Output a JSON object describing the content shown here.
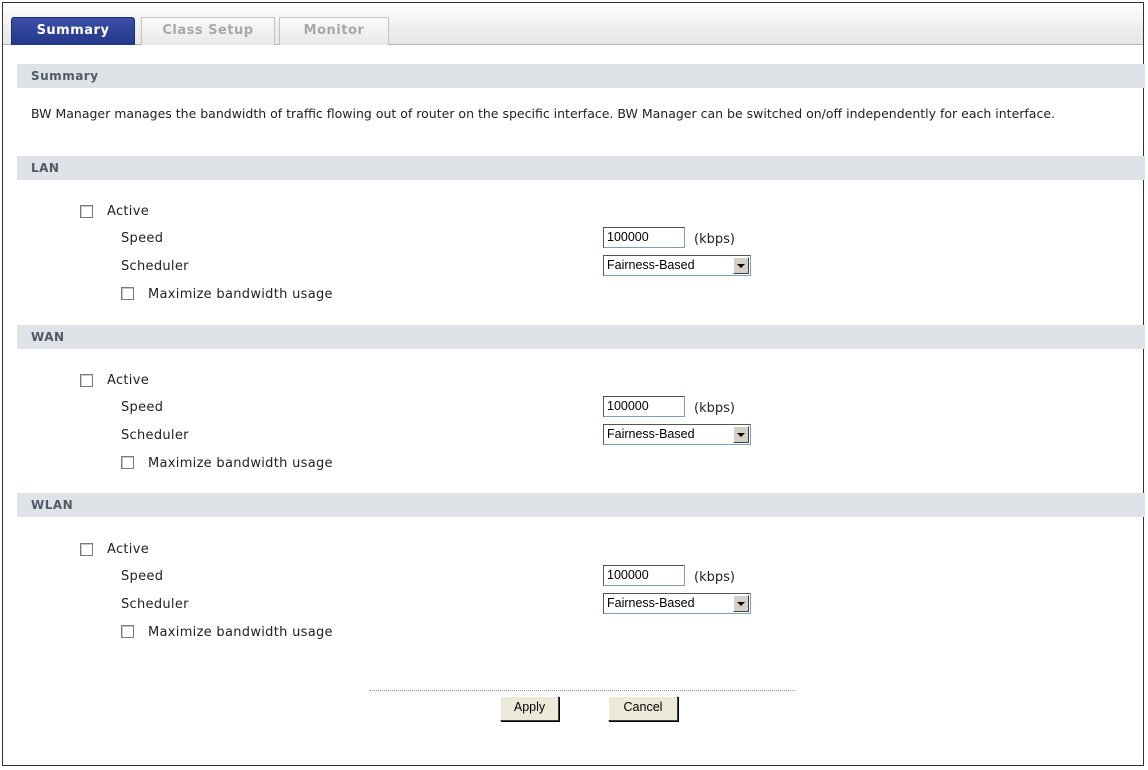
{
  "tabs": [
    {
      "label": "Summary",
      "active": true
    },
    {
      "label": "Class Setup",
      "active": false
    },
    {
      "label": "Monitor",
      "active": false
    }
  ],
  "summary": {
    "heading": "Summary",
    "description": "BW Manager manages the bandwidth of traffic flowing out of router on the specific interface. BW Manager can be switched on/off independently for each interface."
  },
  "interfaces": [
    {
      "name": "LAN",
      "active_label": "Active",
      "active_checked": false,
      "speed_label": "Speed",
      "speed_value": "100000",
      "speed_unit": "(kbps)",
      "scheduler_label": "Scheduler",
      "scheduler_value": "Fairness-Based",
      "maximize_label": "Maximize bandwidth usage",
      "maximize_checked": false
    },
    {
      "name": "WAN",
      "active_label": "Active",
      "active_checked": false,
      "speed_label": "Speed",
      "speed_value": "100000",
      "speed_unit": "(kbps)",
      "scheduler_label": "Scheduler",
      "scheduler_value": "Fairness-Based",
      "maximize_label": "Maximize bandwidth usage",
      "maximize_checked": false
    },
    {
      "name": "WLAN",
      "active_label": "Active",
      "active_checked": false,
      "speed_label": "Speed",
      "speed_value": "100000",
      "speed_unit": "(kbps)",
      "scheduler_label": "Scheduler",
      "scheduler_value": "Fairness-Based",
      "maximize_label": "Maximize bandwidth usage",
      "maximize_checked": false
    }
  ],
  "buttons": {
    "apply": "Apply",
    "cancel": "Cancel"
  },
  "colors": {
    "tab_active": "#23378a",
    "section_bar": "#dfe3e8",
    "section_text": "#505a66"
  }
}
